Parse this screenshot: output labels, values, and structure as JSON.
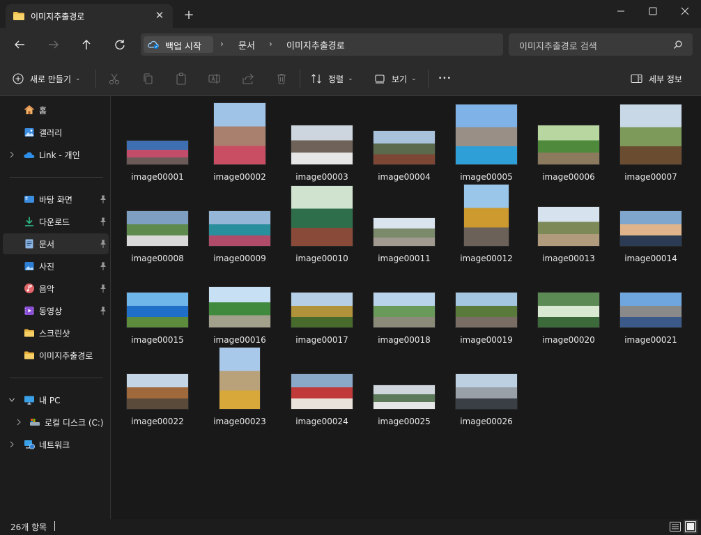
{
  "tab": {
    "title": "이미지추출경로",
    "close_glyph": "✕",
    "new_glyph": "+"
  },
  "address": {
    "root_label": "백업 시작",
    "crumbs": [
      "문서",
      "이미지추출경로"
    ],
    "separator": "›"
  },
  "search": {
    "placeholder": "이미지추출경로 검색"
  },
  "toolbar": {
    "new_label": "새로 만들기",
    "sort_label": "정렬",
    "view_label": "보기",
    "more_glyph": "•••",
    "details_label": "세부 정보",
    "chevron": "⌄"
  },
  "sidebar": {
    "quick": [
      {
        "label": "홈",
        "icon": "home-icon"
      },
      {
        "label": "갤러리",
        "icon": "gallery-icon"
      },
      {
        "label": "Link - 개인",
        "icon": "cloud-icon"
      }
    ],
    "pinned": [
      {
        "label": "바탕 화면",
        "icon": "desktop-icon"
      },
      {
        "label": "다운로드",
        "icon": "download-icon"
      },
      {
        "label": "문서",
        "icon": "document-icon"
      },
      {
        "label": "사진",
        "icon": "pictures-icon"
      },
      {
        "label": "음악",
        "icon": "music-icon"
      },
      {
        "label": "동영상",
        "icon": "video-icon"
      }
    ],
    "folders": [
      {
        "label": "스크린샷",
        "icon": "folder-icon"
      },
      {
        "label": "이미지추출경로",
        "icon": "folder-icon"
      }
    ],
    "devices": [
      {
        "label": "내 PC",
        "icon": "pc-icon"
      },
      {
        "label": "로컬 디스크 (C:)",
        "icon": "drive-icon"
      },
      {
        "label": "네트워크",
        "icon": "network-icon"
      }
    ]
  },
  "files": [
    "image00001",
    "image00002",
    "image00003",
    "image00004",
    "image00005",
    "image00006",
    "image00007",
    "image00008",
    "image00009",
    "image00010",
    "image00011",
    "image00012",
    "image00013",
    "image00014",
    "image00015",
    "image00016",
    "image00017",
    "image00018",
    "image00019",
    "image00020",
    "image00021",
    "image00022",
    "image00023",
    "image00024",
    "image00025",
    "image00026"
  ],
  "status": {
    "item_count": "26개 항목"
  },
  "colors": {
    "accent": "#0078d4",
    "folder": "#f2c14e",
    "background": "#191919"
  }
}
